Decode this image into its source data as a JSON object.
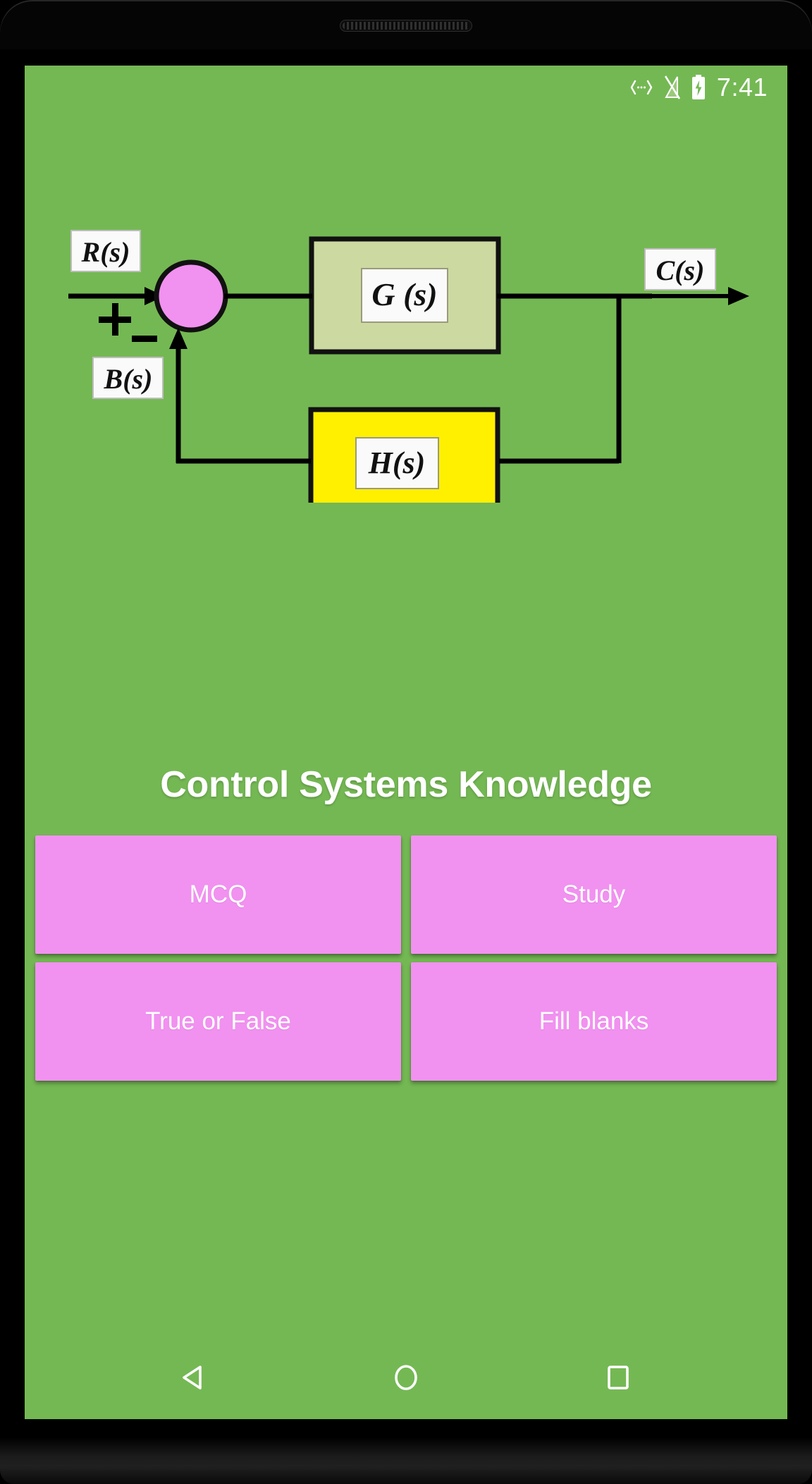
{
  "status_bar": {
    "icons": [
      "data-transfer-icon",
      "signal-off-icon",
      "battery-charging-icon"
    ],
    "time": "7:41"
  },
  "diagram": {
    "alt": "Negative feedback control system block diagram",
    "labels": {
      "input": "R(s)",
      "feedback": "B(s)",
      "output": "C(s)",
      "forward_block": "G (s)",
      "feedback_block": "H(s)",
      "plus_sign": "+",
      "minus_sign": "−"
    },
    "colors": {
      "background": "#74b853",
      "summing_junction": "#f191f0",
      "forward_block": "#ccd9a0",
      "feedback_block": "#fff000",
      "label_box": "#fafafa",
      "line": "#000000"
    }
  },
  "header": {
    "title": "Control Systems Knowledge"
  },
  "menu": {
    "buttons": [
      {
        "label": "MCQ",
        "name": "mcq-button"
      },
      {
        "label": "Study",
        "name": "study-button"
      },
      {
        "label": "True or False",
        "name": "true-or-false-button"
      },
      {
        "label": "Fill blanks",
        "name": "fill-blanks-button"
      }
    ]
  },
  "nav_bar": {
    "back": "back-icon",
    "home": "home-icon",
    "recents": "recents-icon"
  },
  "theme": {
    "screen_background": "#74b853",
    "button_background": "#f191f0",
    "text_on_button": "#ffffff",
    "title_color": "#ffffff"
  }
}
